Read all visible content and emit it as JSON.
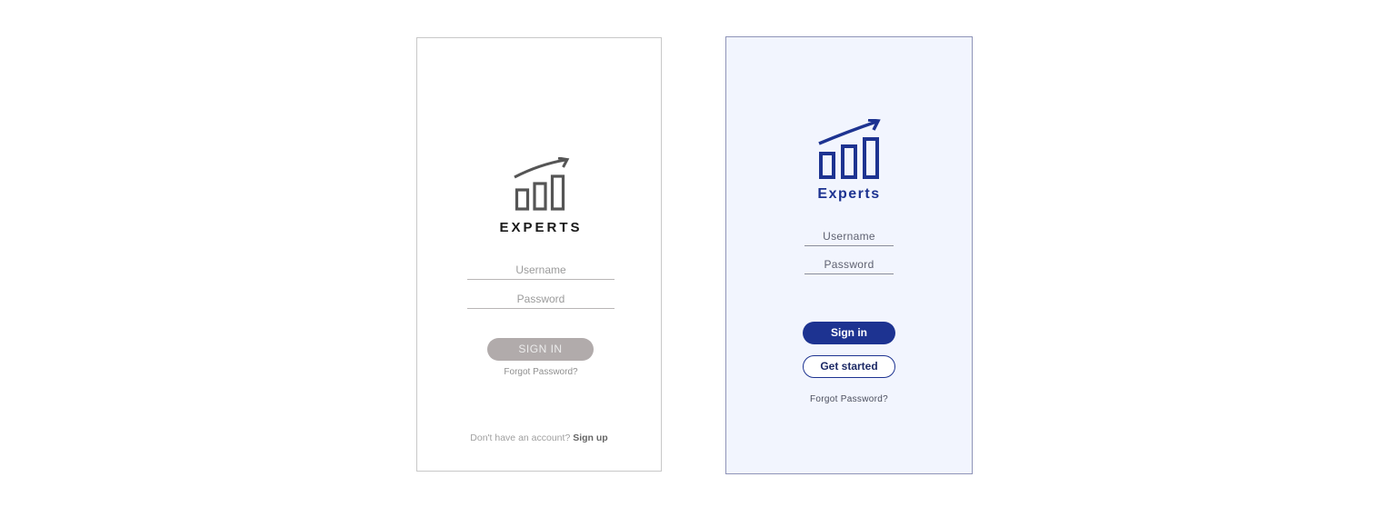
{
  "wireframe": {
    "brand": "EXPERTS",
    "username_placeholder": "Username",
    "password_placeholder": "Password",
    "signin_label": "SIGN IN",
    "forgot_label": "Forgot Password?",
    "no_account_text": "Don't have an account?",
    "signup_label": "Sign up",
    "logo_icon": "growth-chart-icon",
    "colors": {
      "logo": "#555555",
      "button": "#b1abab",
      "border": "#c8c8c8"
    }
  },
  "hifi": {
    "brand": "Experts",
    "username_placeholder": "Username",
    "password_placeholder": "Password",
    "signin_label": "Sign in",
    "getstarted_label": "Get started",
    "forgot_label": "Forgot Password?",
    "logo_icon": "growth-chart-icon",
    "colors": {
      "accent": "#1d3391",
      "background": "#f2f5fe",
      "border": "#8f94b8"
    }
  }
}
